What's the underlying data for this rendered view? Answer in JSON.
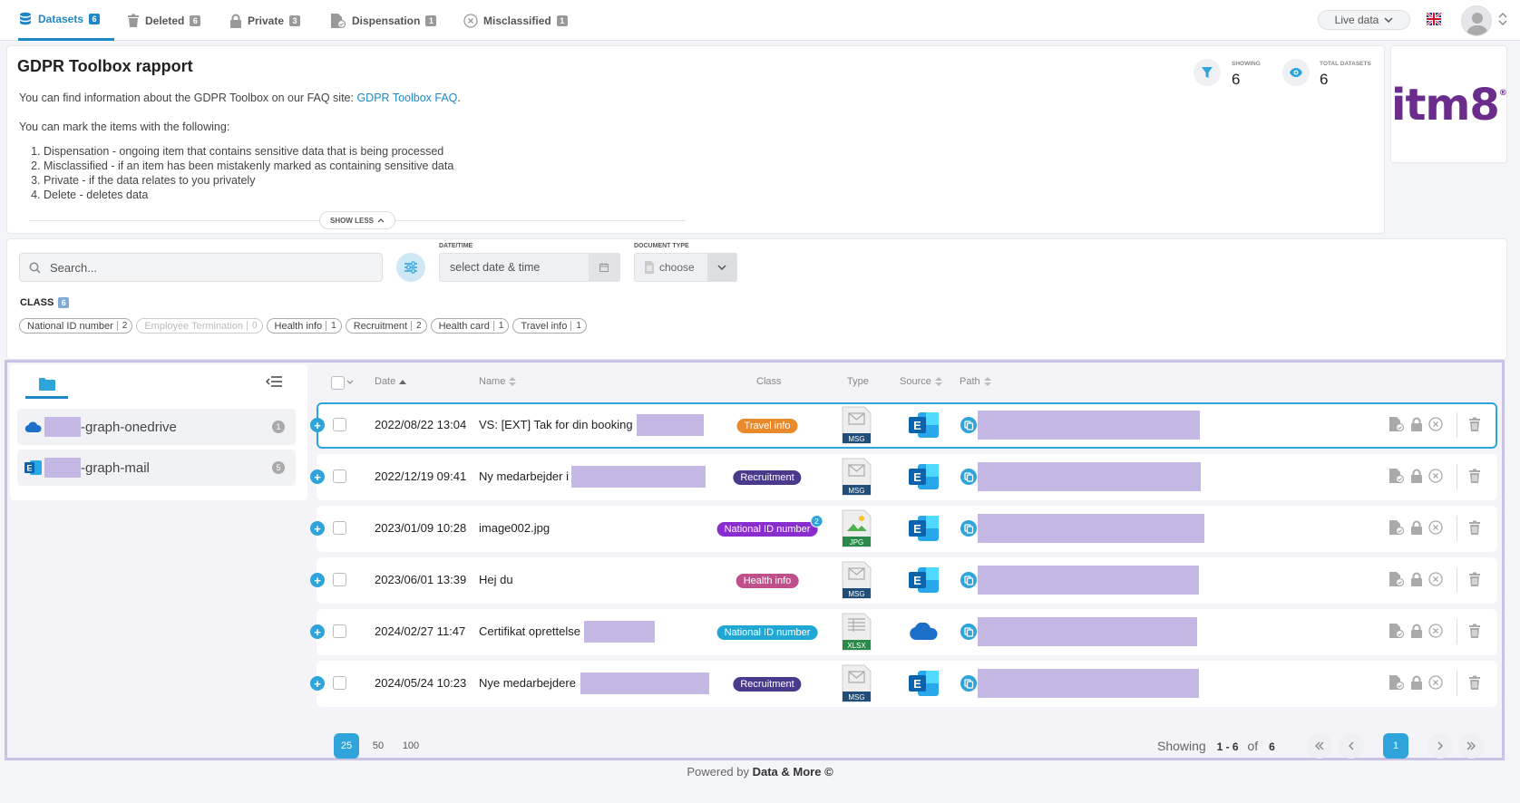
{
  "tabs": [
    {
      "label": "Datasets",
      "count": "6",
      "icon": "database-icon"
    },
    {
      "label": "Deleted",
      "count": "6",
      "icon": "trash-icon"
    },
    {
      "label": "Private",
      "count": "3",
      "icon": "lock-icon"
    },
    {
      "label": "Dispensation",
      "count": "1",
      "icon": "file-check-icon"
    },
    {
      "label": "Misclassified",
      "count": "1",
      "icon": "x-circle-icon"
    }
  ],
  "header": {
    "live_label": "Live data"
  },
  "report": {
    "title": "GDPR Toolbox rapport",
    "info_text": "You can find information about the GDPR Toolbox on our FAQ site: ",
    "faq_link": "GDPR Toolbox FAQ",
    "faq_end": ".",
    "mark_text": "You can mark the items with the following:",
    "steps": [
      "Dispensation - ongoing item that contains sensitive data that is being processed",
      "Misclassified - if an item has been mistakenly marked as containing sensitive data",
      "Private - if the data relates to you privately",
      "Delete - deletes data"
    ],
    "show_less": "SHOW LESS"
  },
  "stats": {
    "showing_label": "SHOWING",
    "showing_value": "6",
    "total_label": "TOTAL DATASETS",
    "total_value": "6"
  },
  "logo": {
    "text": "itm8",
    "mark": "®"
  },
  "filters": {
    "search_placeholder": "Search...",
    "date_label": "DATE/TIME",
    "date_placeholder": "select date & time",
    "type_label": "DOCUMENT TYPE",
    "type_placeholder": "choose",
    "class_label": "CLASS",
    "class_count": "6",
    "chips": [
      {
        "label": "National ID number",
        "count": "2",
        "disabled": false
      },
      {
        "label": "Employee Termination",
        "count": "0",
        "disabled": true
      },
      {
        "label": "Health info",
        "count": "1",
        "disabled": false
      },
      {
        "label": "Recruitment",
        "count": "2",
        "disabled": false
      },
      {
        "label": "Health card",
        "count": "1",
        "disabled": false
      },
      {
        "label": "Travel info",
        "count": "1",
        "disabled": false
      }
    ]
  },
  "sources": [
    {
      "label": "-graph-onedrive",
      "count": "1",
      "icon": "onedrive-icon"
    },
    {
      "label": "-graph-mail",
      "count": "5",
      "icon": "exchange-icon"
    }
  ],
  "table": {
    "headers": {
      "date": "Date",
      "name": "Name",
      "class": "Class",
      "type": "Type",
      "source": "Source",
      "path": "Path"
    },
    "rows": [
      {
        "date": "2022/08/22 13:04",
        "name": "VS: [EXT] Tak for din booking",
        "class": "Travel info",
        "class_color": "#e8892c",
        "type": "MSG",
        "type_color": "#1e4e79",
        "source": "exchange"
      },
      {
        "date": "2022/12/19 09:41",
        "name": "Ny medarbejder i",
        "class": "Recruitment",
        "class_color": "#4a3a8c",
        "type": "MSG",
        "type_color": "#1e4e79",
        "source": "exchange"
      },
      {
        "date": "2023/01/09 10:28",
        "name": "image002.jpg",
        "class": "National ID number",
        "class_color": "#8a2dcf",
        "class_sup": "2",
        "type": "JPG",
        "type_color": "#2a8a4a",
        "source": "exchange"
      },
      {
        "date": "2023/06/01 13:39",
        "name": "Hej du",
        "class": "Health info",
        "class_color": "#c0508c",
        "type": "MSG",
        "type_color": "#1e4e79",
        "source": "exchange"
      },
      {
        "date": "2024/02/27 11:47",
        "name": "Certifikat oprettelse",
        "class": "National ID number",
        "class_color": "#21a7d4",
        "type": "XLSX",
        "type_color": "#2a8a4a",
        "source": "onedrive"
      },
      {
        "date": "2024/05/24 10:23",
        "name": "Nye medarbejdere",
        "class": "Recruitment",
        "class_color": "#4a3a8c",
        "type": "MSG",
        "type_color": "#1e4e79",
        "source": "exchange"
      }
    ]
  },
  "pagination": {
    "sizes": [
      "25",
      "50",
      "100"
    ],
    "showing_prefix": "Showing",
    "range": "1 - 6",
    "of": "of",
    "total": "6",
    "page": "1"
  },
  "footer": {
    "prefix": "Powered by ",
    "brand": "Data & More ©"
  }
}
